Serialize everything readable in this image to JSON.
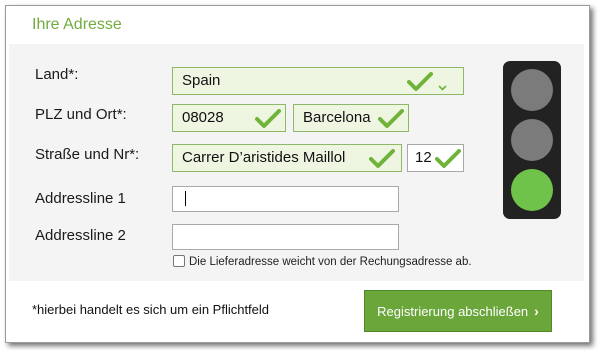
{
  "header": {
    "title": "Ihre Adresse"
  },
  "form": {
    "country": {
      "label": "Land*:",
      "value": "Spain"
    },
    "postal_city": {
      "label": "PLZ und Ort*:",
      "postal_code": "08028",
      "city": "Barcelona"
    },
    "street": {
      "label": "Straße und Nr*:",
      "street": "Carrer D’aristides Maillol",
      "number": "12"
    },
    "address_line_1": {
      "label": "Addressline 1",
      "value": ""
    },
    "address_line_2": {
      "label": "Addressline 2",
      "value": ""
    },
    "delivery_checkbox": {
      "label": "Die Lieferadresse weicht von der Rechungsadresse ab.",
      "checked": false
    }
  },
  "traffic_light": {
    "active": "green",
    "colors": {
      "off": "#7b7b7b",
      "green": "#6fc24a"
    }
  },
  "footer": {
    "note": "*hierbei handelt es sich um ein Pflichtfeld",
    "submit_label": "Registrierung abschließen"
  },
  "icons": {
    "valid": "checkmark-icon",
    "dropdown": "chevron-down-icon",
    "submit": "chevron-right-icon"
  },
  "colors": {
    "accent": "#72ab3e",
    "button": "#6aa63a",
    "valid_bg": "#eef6e2"
  }
}
